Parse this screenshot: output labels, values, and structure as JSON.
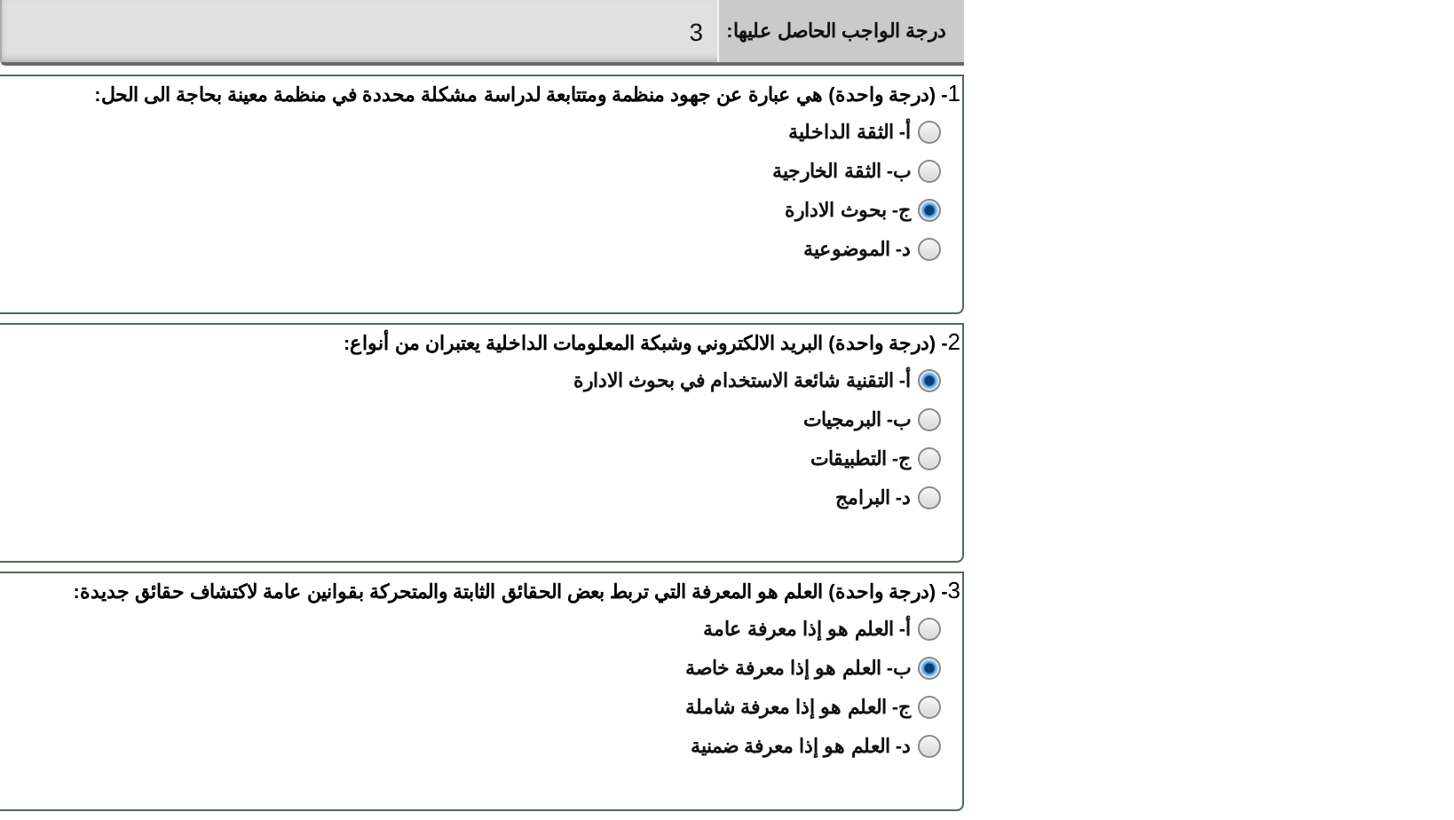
{
  "grade": {
    "label": "درجة الواجب الحاصل عليها:",
    "value": "3"
  },
  "questions": [
    {
      "number": "1",
      "text": "- (درجة واحدة) هي عبارة عن جهود منظمة ومتتابعة لدراسة مشكلة محددة في منظمة معينة بحاجة الى الحل:",
      "options": [
        {
          "label": "أ- الثقة الداخلية",
          "selected": false
        },
        {
          "label": "ب- الثقة الخارجية",
          "selected": false
        },
        {
          "label": "ج- بحوث الادارة",
          "selected": true
        },
        {
          "label": "د- الموضوعية",
          "selected": false
        }
      ]
    },
    {
      "number": "2",
      "text": "- (درجة واحدة) البريد الالكتروني وشبكة المعلومات الداخلية يعتبران من أنواع:",
      "options": [
        {
          "label": "أ- التقنية شائعة الاستخدام في بحوث الادارة",
          "selected": true
        },
        {
          "label": "ب- البرمجيات",
          "selected": false
        },
        {
          "label": "ج- التطبيقات",
          "selected": false
        },
        {
          "label": "د- البرامج",
          "selected": false
        }
      ]
    },
    {
      "number": "3",
      "text": "- (درجة واحدة) العلم هو المعرفة التي تربط بعض الحقائق الثابتة والمتحركة بقوانين عامة لاكتشاف حقائق جديدة:",
      "options": [
        {
          "label": "أ- العلم هو إذا معرفة عامة",
          "selected": false
        },
        {
          "label": "ب- العلم هو إذا معرفة خاصة",
          "selected": true
        },
        {
          "label": "ج- العلم هو إذا معرفة شاملة",
          "selected": false
        },
        {
          "label": "د- العلم هو إذا معرفة ضمنية",
          "selected": false
        }
      ]
    }
  ]
}
